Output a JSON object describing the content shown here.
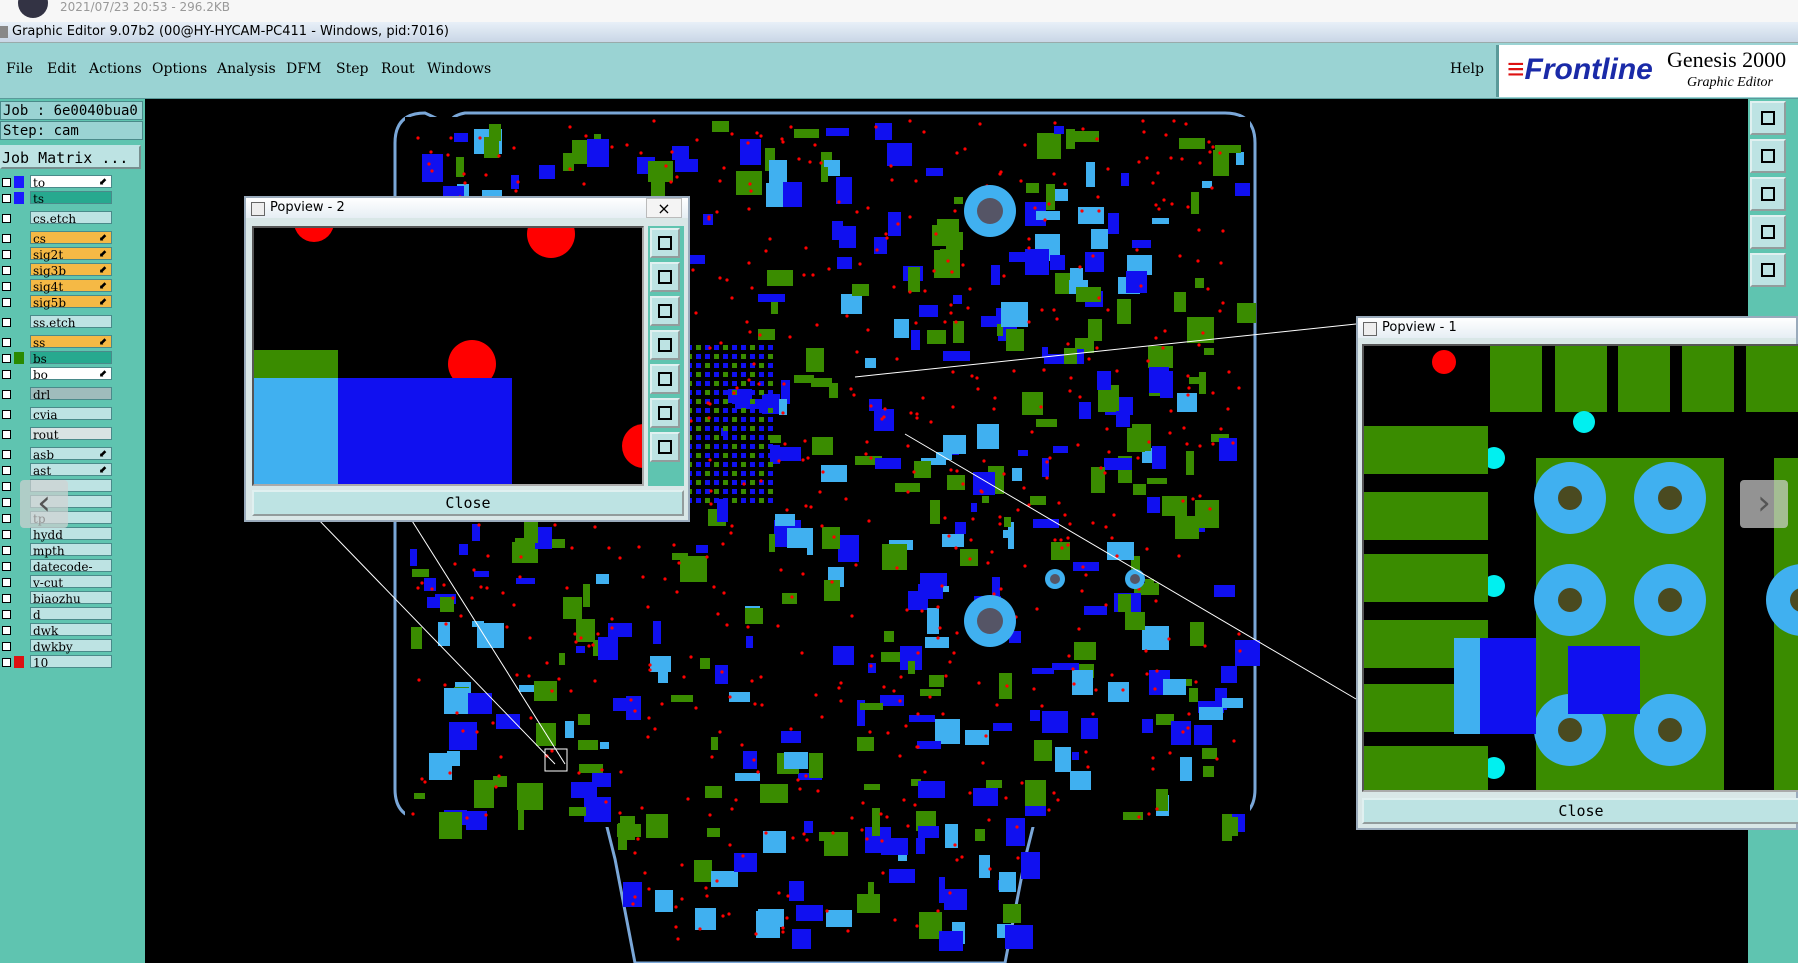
{
  "viewer": {
    "meta": "2021/07/23 20:53 - 296.2KB"
  },
  "window": {
    "title": "Graphic Editor 9.07b2 (00@HY-HYCAM-PC411 - Windows, pid:7016)"
  },
  "menu": {
    "items": [
      "File",
      "Edit",
      "Actions",
      "Options",
      "Analysis",
      "DFM",
      "Step",
      "Rout",
      "Windows"
    ],
    "help": "Help"
  },
  "logo": {
    "brand": "Frontline",
    "product": "Genesis 2000",
    "subtitle": "Graphic Editor"
  },
  "job": {
    "job_line": "Job : 6e0040bua0",
    "step_line": "Step: cam",
    "matrix_button": "Job Matrix ..."
  },
  "layers": [
    {
      "name": "to",
      "color": "#1a1aff",
      "fill": "#ffffff",
      "arrow": "⬋"
    },
    {
      "name": "ts",
      "color": "#1a1aff",
      "fill": "#27a98f",
      "arrow": ""
    },
    {
      "name": "cs.etch",
      "color": "",
      "fill": "#bde3e3",
      "arrow": ""
    },
    {
      "name": "cs",
      "color": "",
      "fill": "#f5b945",
      "arrow": "⬋"
    },
    {
      "name": "sig2t",
      "color": "",
      "fill": "#f5b945",
      "arrow": "⬋"
    },
    {
      "name": "sig3b",
      "color": "",
      "fill": "#f5b945",
      "arrow": "⬋"
    },
    {
      "name": "sig4t",
      "color": "",
      "fill": "#f5b945",
      "arrow": "⬋"
    },
    {
      "name": "sig5b",
      "color": "",
      "fill": "#f5b945",
      "arrow": "⬋"
    },
    {
      "name": "ss.etch",
      "color": "",
      "fill": "#bde3e3",
      "arrow": ""
    },
    {
      "name": "ss",
      "color": "",
      "fill": "#f5b945",
      "arrow": "⬋"
    },
    {
      "name": "bs",
      "color": "#2a8a00",
      "fill": "#27a98f",
      "arrow": ""
    },
    {
      "name": "bo",
      "color": "",
      "fill": "#ffffff",
      "arrow": "⬋"
    },
    {
      "name": "drl",
      "color": "",
      "fill": "#9fbcbc",
      "arrow": ""
    },
    {
      "name": "cvia",
      "color": "",
      "fill": "#bde3e3",
      "arrow": ""
    },
    {
      "name": "rout",
      "color": "",
      "fill": "#d9e3e3",
      "arrow": ""
    },
    {
      "name": "asb",
      "color": "",
      "fill": "#bde3e3",
      "arrow": "⬋"
    },
    {
      "name": "ast",
      "color": "",
      "fill": "#bde3e3",
      "arrow": "⬋"
    },
    {
      "name": "",
      "color": "",
      "fill": "#bde3e3",
      "arrow": ""
    },
    {
      "name": "",
      "color": "",
      "fill": "#bde3e3",
      "arrow": ""
    },
    {
      "name": "tp",
      "color": "",
      "fill": "#bde3e3",
      "arrow": ""
    },
    {
      "name": "hydd",
      "color": "",
      "fill": "#bde3e3",
      "arrow": ""
    },
    {
      "name": "mpth",
      "color": "",
      "fill": "#bde3e3",
      "arrow": ""
    },
    {
      "name": "datecode-pte",
      "color": "",
      "fill": "#bde3e3",
      "arrow": ""
    },
    {
      "name": "v-cut",
      "color": "",
      "fill": "#bde3e3",
      "arrow": ""
    },
    {
      "name": "biaozhu",
      "color": "",
      "fill": "#bde3e3",
      "arrow": ""
    },
    {
      "name": "d",
      "color": "",
      "fill": "#bde3e3",
      "arrow": ""
    },
    {
      "name": "dwk",
      "color": "",
      "fill": "#bde3e3",
      "arrow": ""
    },
    {
      "name": "dwkby",
      "color": "",
      "fill": "#bde3e3",
      "arrow": ""
    },
    {
      "name": "10",
      "color": "#d11",
      "fill": "#bde3e3",
      "arrow": ""
    }
  ],
  "popview2": {
    "title": "Popview - 2",
    "close_label": "Close",
    "close_x": "×"
  },
  "popview1": {
    "title": "Popview - 1",
    "close_label": "Close"
  },
  "colors": {
    "pad_blue": "#1010f0",
    "pad_lightblue": "#40b0f0",
    "pad_green": "#3a8c00",
    "drill_red": "#ff0000",
    "via_cyan": "#00f0f0",
    "panel": "#9ad3d3",
    "outline": "#7aa7d8"
  }
}
